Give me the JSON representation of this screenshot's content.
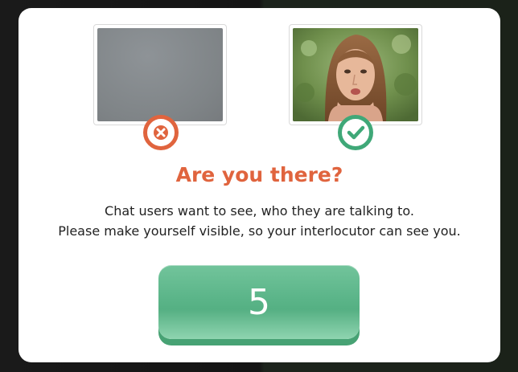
{
  "dialog": {
    "title": "Are you there?",
    "message_line1": "Chat users want to see, who they are talking to.",
    "message_line2": "Please make yourself visible, so your interlocutor can see you.",
    "countdown": "5"
  },
  "previews": [
    {
      "name": "self-camera-preview",
      "status_icon": "x-icon",
      "status_color": "#e0643e"
    },
    {
      "name": "partner-camera-preview",
      "status_icon": "check-icon",
      "status_color": "#3fa878"
    }
  ],
  "colors": {
    "accent_orange": "#e0643e",
    "accent_green": "#3fa878",
    "button_green": "#5bb589"
  }
}
